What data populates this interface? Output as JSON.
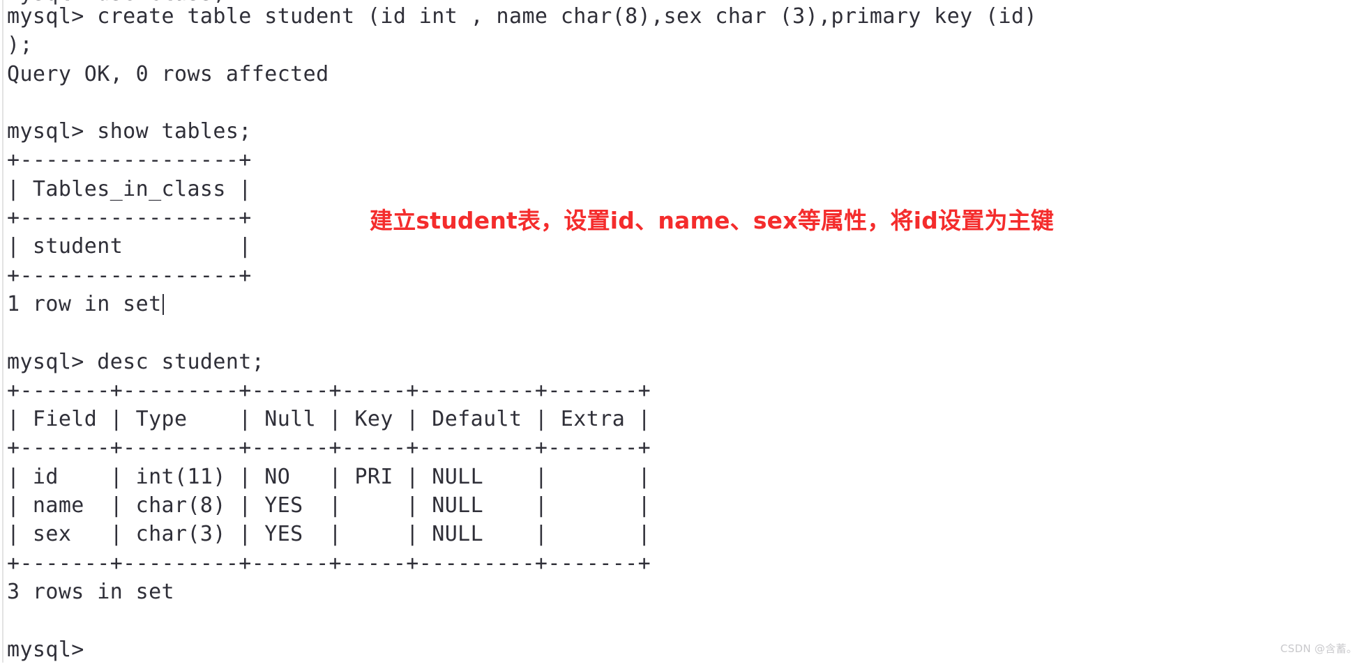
{
  "console": {
    "prompt": "mysql>",
    "clipped_top_line": "mysql> use class;",
    "lines": [
      {
        "id": "create-table-command",
        "text": "mysql> create table student (id int , name char(8),sex char (3),primary key (id)",
        "kind": "command"
      },
      {
        "id": "create-table-continuation",
        "text": ");",
        "kind": "command"
      },
      {
        "id": "create-table-result",
        "text": "Query OK, 0 rows affected",
        "kind": "output"
      },
      {
        "id": "blank-1",
        "text": "",
        "kind": "blank"
      },
      {
        "id": "show-tables-command",
        "text": "mysql> show tables;",
        "kind": "command"
      },
      {
        "id": "show-tables-sep-top",
        "text": "+-----------------+",
        "kind": "output"
      },
      {
        "id": "show-tables-header",
        "text": "| Tables_in_class |",
        "kind": "output"
      },
      {
        "id": "show-tables-sep-mid",
        "text": "+-----------------+",
        "kind": "output"
      },
      {
        "id": "show-tables-row-1",
        "text": "| student         |",
        "kind": "output"
      },
      {
        "id": "show-tables-sep-bottom",
        "text": "+-----------------+",
        "kind": "output"
      },
      {
        "id": "show-tables-rowcount",
        "text": "1 row in set",
        "kind": "output",
        "caret": true
      },
      {
        "id": "blank-2",
        "text": "",
        "kind": "blank"
      },
      {
        "id": "desc-student-command",
        "text": "mysql> desc student;",
        "kind": "command"
      },
      {
        "id": "desc-sep-top",
        "text": "+-------+---------+------+-----+---------+-------+",
        "kind": "output"
      },
      {
        "id": "desc-header",
        "text": "| Field | Type    | Null | Key | Default | Extra |",
        "kind": "output"
      },
      {
        "id": "desc-sep-mid",
        "text": "+-------+---------+------+-----+---------+-------+",
        "kind": "output"
      },
      {
        "id": "desc-row-id",
        "text": "| id    | int(11) | NO   | PRI | NULL    |       |",
        "kind": "output"
      },
      {
        "id": "desc-row-name",
        "text": "| name  | char(8) | YES  |     | NULL    |       |",
        "kind": "output"
      },
      {
        "id": "desc-row-sex",
        "text": "| sex   | char(3) | YES  |     | NULL    |       |",
        "kind": "output"
      },
      {
        "id": "desc-sep-bottom",
        "text": "+-------+---------+------+-----+---------+-------+",
        "kind": "output"
      },
      {
        "id": "desc-rowcount",
        "text": "3 rows in set",
        "kind": "output"
      },
      {
        "id": "blank-3",
        "text": "",
        "kind": "blank"
      },
      {
        "id": "final-prompt",
        "text": "mysql>",
        "kind": "command"
      }
    ]
  },
  "show_tables_result": {
    "columns": [
      "Tables_in_class"
    ],
    "rows": [
      [
        "student"
      ]
    ],
    "row_count_text": "1 row in set"
  },
  "desc_student_result": {
    "columns": [
      "Field",
      "Type",
      "Null",
      "Key",
      "Default",
      "Extra"
    ],
    "rows": [
      [
        "id",
        "int(11)",
        "NO",
        "PRI",
        "NULL",
        ""
      ],
      [
        "name",
        "char(8)",
        "YES",
        "",
        "NULL",
        ""
      ],
      [
        "sex",
        "char(3)",
        "YES",
        "",
        "NULL",
        ""
      ]
    ],
    "row_count_text": "3 rows in set"
  },
  "annotation": {
    "text": "建立student表，设置id、name、sex等属性，将id设置为主键",
    "color": "#f42c2c"
  },
  "watermark": {
    "text": "CSDN @含蓄。",
    "color": "#c9c9cc"
  },
  "colors": {
    "background": "#ffffff",
    "text": "#2f2f38",
    "gutter": "#e3e3e3",
    "annotation_red": "#f42c2c",
    "watermark_grey": "#c9c9cc"
  }
}
